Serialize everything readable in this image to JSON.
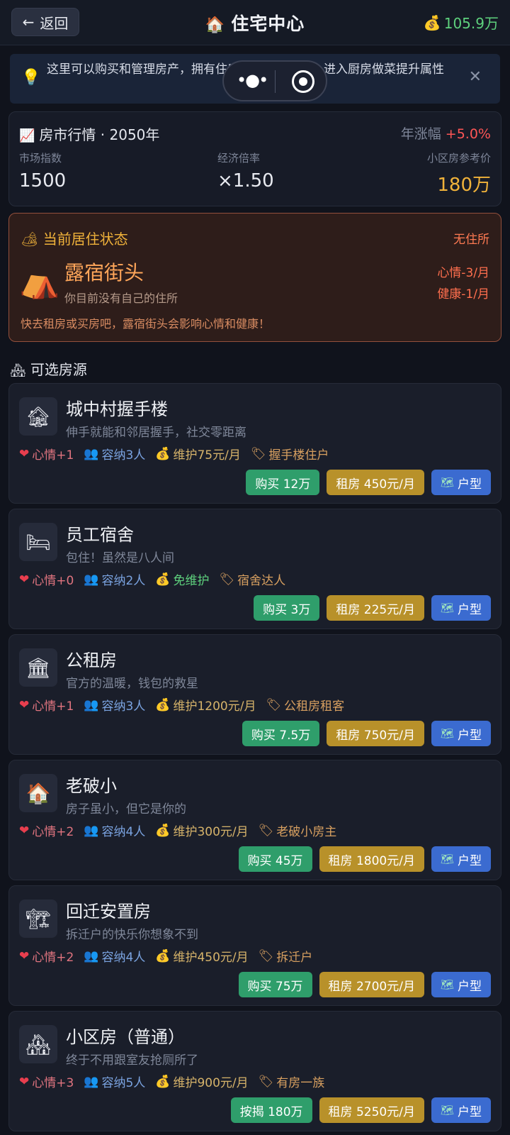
{
  "header": {
    "back_label": "返回",
    "title": "住宅中心",
    "money": "105.9万"
  },
  "tip": {
    "text": "这里可以购买和管理房产，拥有住房后可查看户型、进入厨房做菜提升属性"
  },
  "market": {
    "title": "房市行情 · 2050年",
    "growth_label": "年涨幅",
    "growth_value": "+5.0%",
    "index_label": "市场指数",
    "index_value": "1500",
    "multiplier_label": "经济倍率",
    "multiplier_value": "×1.50",
    "ref_label": "小区房参考价",
    "ref_value": "180万"
  },
  "residence": {
    "header": "当前居住状态",
    "tag": "无住所",
    "name": "露宿街头",
    "sub": "你目前没有自己的住所",
    "effect_mood": "心情-3/月",
    "effect_health": "健康-1/月",
    "warning": "快去租房或买房吧，露宿街头会影响心情和健康！"
  },
  "section_title": "可选房源",
  "houses": [
    {
      "icon": "🏚",
      "name": "城中村握手楼",
      "desc": "伸手就能和邻居握手，社交零距离",
      "mood": "心情+1",
      "capacity": "容纳3人",
      "maint": "维护75元/月",
      "title": "握手楼住户",
      "buy": "购买 12万",
      "rent": "租房 450元/月",
      "plan": "户型"
    },
    {
      "icon": "🛏",
      "name": "员工宿舍",
      "desc": "包住！虽然是八人间",
      "mood": "心情+0",
      "capacity": "容纳2人",
      "maint": "免维护",
      "title": "宿舍达人",
      "buy": "购买 3万",
      "rent": "租房 225元/月",
      "plan": "户型"
    },
    {
      "icon": "🏛",
      "name": "公租房",
      "desc": "官方的温暖，钱包的救星",
      "mood": "心情+1",
      "capacity": "容纳3人",
      "maint": "维护1200元/月",
      "title": "公租房租客",
      "buy": "购买 7.5万",
      "rent": "租房 750元/月",
      "plan": "户型"
    },
    {
      "icon": "🏠",
      "name": "老破小",
      "desc": "房子虽小，但它是你的",
      "mood": "心情+2",
      "capacity": "容纳4人",
      "maint": "维护300元/月",
      "title": "老破小房主",
      "buy": "购买 45万",
      "rent": "租房 1800元/月",
      "plan": "户型"
    },
    {
      "icon": "🏗",
      "name": "回迁安置房",
      "desc": "拆迁户的快乐你想象不到",
      "mood": "心情+2",
      "capacity": "容纳4人",
      "maint": "维护450元/月",
      "title": "拆迁户",
      "buy": "购买 75万",
      "rent": "租房 2700元/月",
      "plan": "户型"
    },
    {
      "icon": "🏘",
      "name": "小区房（普通）",
      "desc": "终于不用跟室友抢厕所了",
      "mood": "心情+3",
      "capacity": "容纳5人",
      "maint": "维护900元/月",
      "title": "有房一族",
      "buy": "按揭 180万",
      "rent": "租房 5250元/月",
      "plan": "户型"
    }
  ],
  "colors": {
    "background": "#10131c",
    "buy": "#2f9e6b",
    "rent": "#b8912a",
    "plan": "#3b6bd0",
    "money": "#5ed17d",
    "warning_border": "#93503c"
  }
}
